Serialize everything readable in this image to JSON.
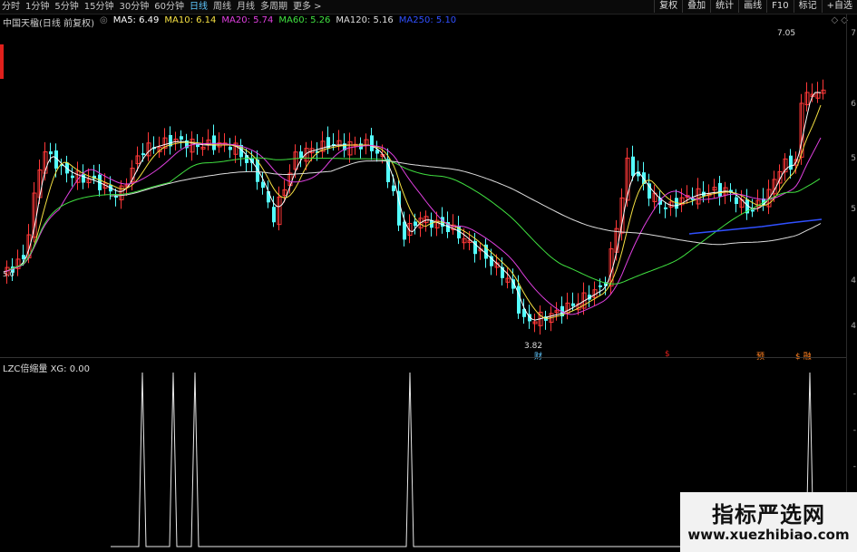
{
  "toolbar": {
    "periods": [
      "分时",
      "1分钟",
      "5分钟",
      "15分钟",
      "30分钟",
      "60分钟",
      "日线",
      "周线",
      "月线",
      "多周期",
      "更多 >"
    ],
    "active_period": "日线",
    "tools": [
      "复权",
      "叠加",
      "统计",
      "画线",
      "F10",
      "标记",
      "+自选"
    ]
  },
  "stock": {
    "title": "中国天楹(日线 前复权)"
  },
  "ma": [
    {
      "label": "MA5: 6.49",
      "color": "#ffffff"
    },
    {
      "label": "MA10: 6.14",
      "color": "#f5e042"
    },
    {
      "label": "MA20: 5.74",
      "color": "#e040e0"
    },
    {
      "label": "MA60: 5.26",
      "color": "#40e040"
    },
    {
      "label": "MA120: 5.16",
      "color": "#dddddd"
    },
    {
      "label": "MA250: 5.10",
      "color": "#3050ff"
    }
  ],
  "price_axis": [
    "7",
    "6",
    "5",
    "5",
    "4",
    "4"
  ],
  "vol_axis": [
    "-",
    "-",
    "-",
    "-"
  ],
  "labels": {
    "high": "7.05",
    "low": "3.82",
    "start_low": "5.0",
    "high_icons": "◇ ◇"
  },
  "events": [
    {
      "text": "财",
      "color": "#5fc8ff"
    },
    {
      "text": "$",
      "color": "#e0201c"
    },
    {
      "text": "预",
      "color": "#ff8020"
    },
    {
      "text": "$ 融",
      "color": "#ff8020"
    }
  ],
  "indicator": {
    "title": "LZC倍缩量 XG: 0.00",
    "gear": "◎"
  },
  "watermark": {
    "title": "指标严选网",
    "url": "www.xuezhibiao.com"
  },
  "colors": {
    "up": "#ff3838",
    "down": "#54ffff",
    "ma5": "#ffffff",
    "ma10": "#f5e042",
    "ma20": "#e040e0",
    "ma60": "#40e040",
    "ma120": "#dddddd",
    "ma250": "#3050ff"
  }
}
